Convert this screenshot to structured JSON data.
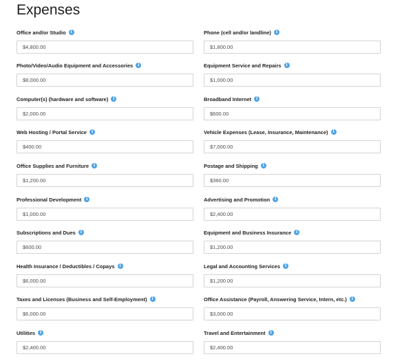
{
  "page": {
    "title": "Expenses"
  },
  "colors": {
    "info_icon": "#4ea3e6",
    "input_border": "#d3d3d3",
    "label_text": "#222222"
  },
  "fields": [
    {
      "label": "Office and/or Studio",
      "value": "$4,800.00",
      "icon": "info-icon"
    },
    {
      "label": "Phone (cell and/or landline)",
      "value": "$1,800.00",
      "icon": "info-icon"
    },
    {
      "label": "Photo/Video/Audio Equipment and Accessories",
      "value": "$8,000.00",
      "icon": "info-icon"
    },
    {
      "label": "Equipment Service and Repairs",
      "value": "$1,000.00",
      "icon": "info-icon"
    },
    {
      "label": "Computer(s) (hardware and software)",
      "value": "$2,000.00",
      "icon": "info-icon"
    },
    {
      "label": "Broadband Internet",
      "value": "$600.00",
      "icon": "info-icon"
    },
    {
      "label": "Web Hosting / Portal Service",
      "value": "$400.00",
      "icon": "info-icon"
    },
    {
      "label": "Vehicle Expenses (Lease, Insurance, Maintenance)",
      "value": "$7,000.00",
      "icon": "info-icon"
    },
    {
      "label": "Office Supplies and Furniture",
      "value": "$1,200.00",
      "icon": "info-icon"
    },
    {
      "label": "Postage and Shipping",
      "value": "$360.00",
      "icon": "info-icon"
    },
    {
      "label": "Professional Development",
      "value": "$1,000.00",
      "icon": "info-icon"
    },
    {
      "label": "Advertising and Promotion",
      "value": "$2,400.00",
      "icon": "info-icon"
    },
    {
      "label": "Subscriptions and Dues",
      "value": "$600.00",
      "icon": "info-icon"
    },
    {
      "label": "Equipment and Business Insurance",
      "value": "$1,200.00",
      "icon": "info-icon"
    },
    {
      "label": "Health Insurance / Deductibles / Copays",
      "value": "$6,000.00",
      "icon": "info-icon"
    },
    {
      "label": "Legal and Accounting Services",
      "value": "$1,200.00",
      "icon": "info-icon"
    },
    {
      "label": "Taxes and Licenses (Business and Self-Employment)",
      "value": "$6,000.00",
      "icon": "info-icon"
    },
    {
      "label": "Office Assistance (Payroll, Answering Service, Intern, etc.)",
      "value": "$3,000.00",
      "icon": "info-icon"
    },
    {
      "label": "Utilities",
      "value": "$2,400.00",
      "icon": "info-icon"
    },
    {
      "label": "Travel and Entertainment",
      "value": "$2,400.00",
      "icon": "info-icon"
    }
  ]
}
